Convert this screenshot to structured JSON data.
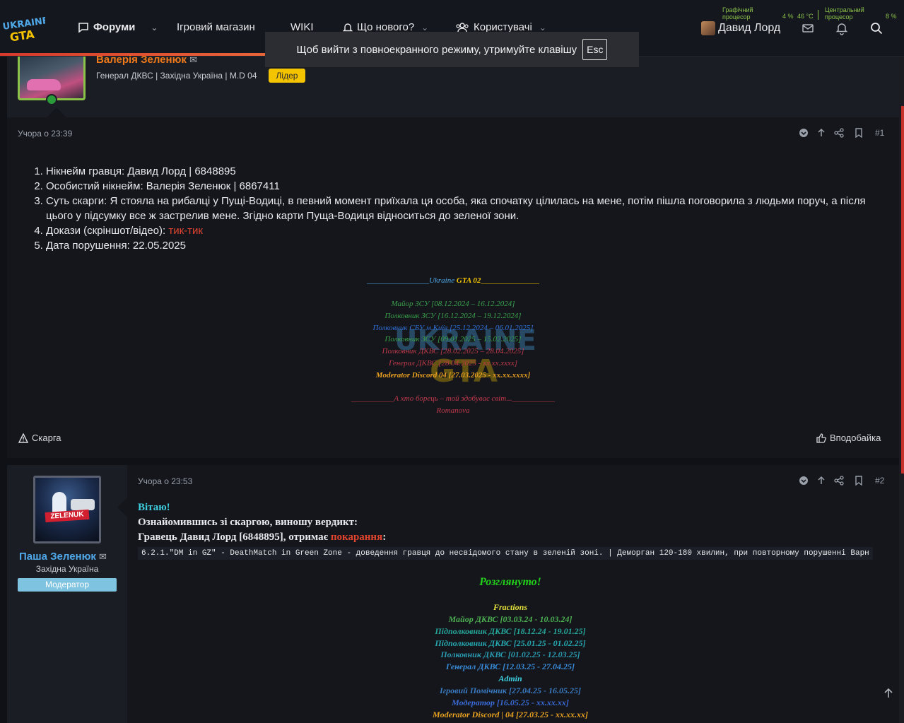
{
  "nav": {
    "logo_text": "UKRAINE GTA",
    "forums": "Форуми",
    "shop": "Ігровий магазин",
    "wiki": "WIKI",
    "whats_new": "Що нового?",
    "members": "Користувачі",
    "user_name": "Давид Лорд"
  },
  "hw": {
    "gpu_label": "Графічний процесор",
    "gpu_load": "4 %",
    "gpu_temp": "46 °C",
    "cpu_label": "Центральний процесор",
    "cpu_load": "8 %"
  },
  "toast": {
    "text": "Щоб вийти з повноекранного режиму, утримуйте клавішу",
    "key": "Esc"
  },
  "post1": {
    "author": "Валерія Зеленюк",
    "title": "Генерал ДКВС | Західна Україна | M.D 04",
    "badge": "Лідер",
    "date": "Учора о 23:39",
    "number": "#1",
    "items": [
      "Нікнейм гравця: Давид Лорд | 6848895",
      "Особистий нікнейм: Валерія Зеленюк | 6867411",
      "Суть скарги: Я стояла на рибалці у Пущі-Водиці, в певний момент приїхала ця особа, яка спочатку цілилась на мене, потім пішла поговорила з людьми поруч, а після цього у підсумку все ж застрелив мене. Згідно карти Пуща-Водиця відноситься до зеленої зони.",
      "Докази (скріншот/відео): ",
      "Дата порушення: 22.05.2025"
    ],
    "evidence_link": "тик-тик",
    "signature": {
      "head_pre": "________________",
      "head_ukraine": "Ukraine",
      "head_gta": " GTA 02",
      "head_post": "_______________",
      "lines": [
        {
          "text": "Майор ЗСУ [08.12.2024 – 16.12.2024]",
          "color": "#3aa04a"
        },
        {
          "text": "Полковник ЗСУ [16.12.2024 – 19.12.2024]",
          "color": "#3aa04a"
        },
        {
          "text": "Полковник СБУ м.Київ [25.12.2024 – 06.01.2025]",
          "color": "#2f6fd6"
        },
        {
          "text": "Полковник ЗСУ [09.01.2025 – 15.02.2025]",
          "color": "#3aa04a"
        },
        {
          "text": "Полковник ДКВС [28.02.2025 – 28.04.2025]",
          "color": "#c0394a"
        },
        {
          "text": "Генерал ДКВС [28.04.2025 - xx.xx.xxxx]",
          "color": "#c0394a"
        },
        {
          "text": "Moderator Discord 04 [27.03.2025 - xx.xx.xxxx]",
          "color": "#e8a020"
        }
      ],
      "motto": "___________А хто борець – той здобуває світ...___________",
      "name": "Romanova"
    },
    "complaint": "Скарга",
    "like": "Вподобайка"
  },
  "post2": {
    "author": "Паша Зеленюк",
    "avatar_tag": "ZELENUK",
    "region": "Західна Україна",
    "badge": "Модератор",
    "date": "Учора о 23:53",
    "number": "#2",
    "greeting": "Вітаю!",
    "line1": "Ознайомившись зі скаргою, виношу вердикт:",
    "line2_pre": "Гравець Давид Лорд [6848895], отримає ",
    "line2_red": "покарання",
    "line2_post": ":",
    "rule": "6.2.1.\"DM in GZ\" - DeathMatch in Green Zone - доведення гравця до несвідомого стану в зеленій зоні. | Деморган 120-180 хвилин, при повторному порушенні Варн",
    "reviewed": "Розглянуто!",
    "signature": [
      {
        "text": "Fractions",
        "color": "#e6e23a"
      },
      {
        "text": "Майор ДКВС [03.03.24 - 10.03.24]",
        "color": "#4caf50"
      },
      {
        "text": "Підполковник ДКВС [18.12.24 - 19.01.25]",
        "color": "#26a69a"
      },
      {
        "text": "Підполковник ДКВС [25.01.25 - 01.02.25]",
        "color": "#26a6b0"
      },
      {
        "text": "Полковник ДКВС [01.02.25 - 12.03.25]",
        "color": "#2a9ab0"
      },
      {
        "text": "Генерал ДКВС [12.03.25 - 27.04.25]",
        "color": "#3a8ad6"
      },
      {
        "text": "Admin",
        "color": "#3fd0e0"
      },
      {
        "text": "Ігровий Помічник [27.04.25 - 16.05.25]",
        "color": "#3a7ac0"
      },
      {
        "text": "Модератор [16.05.25 - xx.xx.xx]",
        "color": "#3a6ad6"
      },
      {
        "text": "Moderator Discord | 04 [27.03.25 - xx.xx.xx]",
        "color": "#e8a020"
      }
    ]
  },
  "colors": {
    "accent": "#d63a2b",
    "author1": "#f07a1a",
    "author2": "#4fa8e8",
    "leader": "#f5c400",
    "moderator": "#7ec3e0",
    "reviewed": "#22d11a",
    "greeting": "#3fd0e0"
  }
}
